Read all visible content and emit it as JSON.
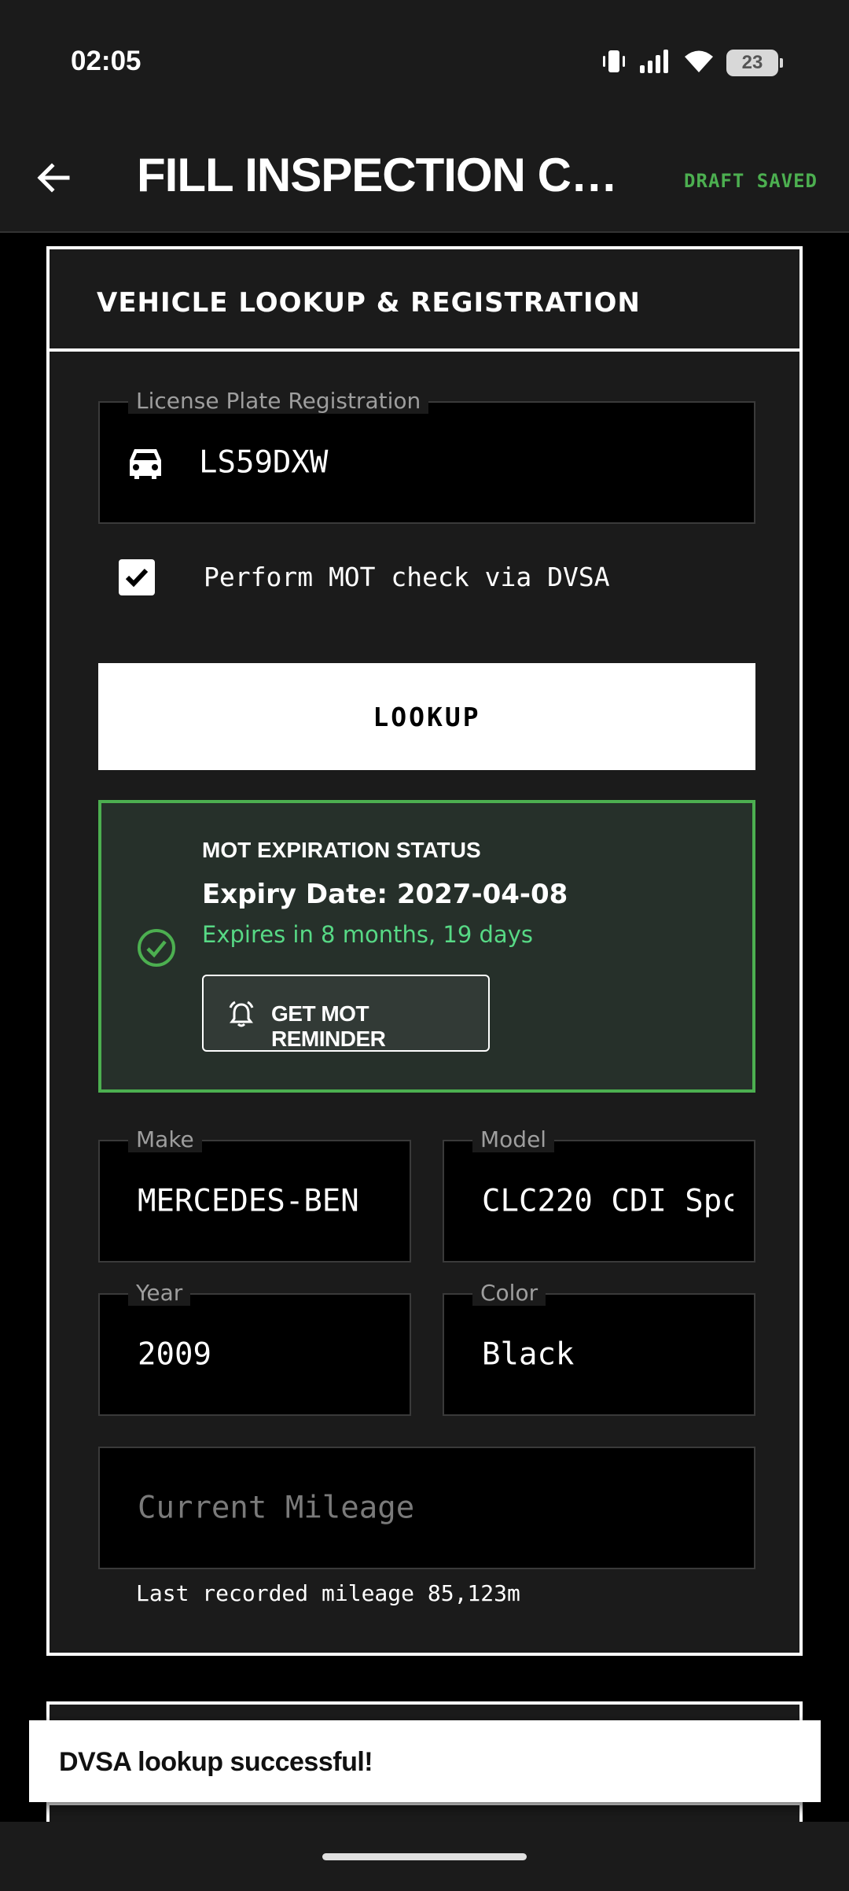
{
  "status_bar": {
    "time": "02:05",
    "battery": "23",
    "icons": [
      "vibrate-icon",
      "signal-icon",
      "wifi-icon",
      "battery-icon"
    ]
  },
  "app_bar": {
    "title": "FILL INSPECTION CHE...",
    "draft_status": "DRAFT SAVED",
    "back_icon": "arrow-left-icon"
  },
  "colors": {
    "background": "#000000",
    "surface": "#1b1b1b",
    "accent_green": "#4caf50",
    "success_text": "#57d985",
    "border": "#ffffff"
  },
  "vehicle_card": {
    "header": "VEHICLE LOOKUP & REGISTRATION",
    "plate": {
      "label": "License Plate Registration",
      "value": "LS59DXW",
      "icon": "car-icon"
    },
    "mot_checkbox": {
      "label": "Perform MOT check via DVSA",
      "checked": true
    },
    "lookup_button": "LOOKUP",
    "mot_status": {
      "title": "MOT EXPIRATION STATUS",
      "expiry": "Expiry Date: 2027-04-08",
      "remaining": "Expires in 8 months, 19 days",
      "reminder_button": "GET MOT REMINDER",
      "icon": "check-circle-icon"
    },
    "make": {
      "label": "Make",
      "value": "MERCEDES-BEN"
    },
    "model": {
      "label": "Model",
      "value": "CLC220 CDI Spc"
    },
    "year": {
      "label": "Year",
      "value": "2009"
    },
    "color": {
      "label": "Color",
      "value": "Black"
    },
    "mileage": {
      "placeholder": "Current Mileage",
      "helper": "Last recorded mileage 85,123m"
    }
  },
  "toast": {
    "message": "DVSA lookup successful!"
  }
}
